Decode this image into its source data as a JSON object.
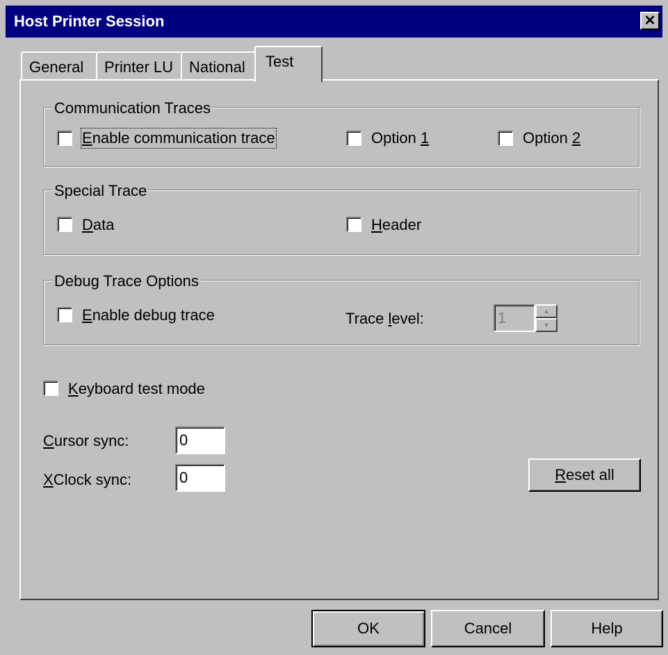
{
  "window": {
    "title": "Host Printer Session",
    "close_glyph": "✕"
  },
  "tabs": [
    {
      "label": "General",
      "active": false
    },
    {
      "label": "Printer LU",
      "active": false
    },
    {
      "label": "National",
      "active": false
    },
    {
      "label": "Test",
      "active": true
    }
  ],
  "communication_traces": {
    "title": "Communication Traces",
    "enable": {
      "label_ul": "E",
      "label_rest": "nable communication trace",
      "checked": false
    },
    "option1": {
      "label_pre": "Option ",
      "label_ul": "1",
      "checked": false
    },
    "option2": {
      "label_pre": "Option ",
      "label_ul": "2",
      "checked": false
    }
  },
  "special_trace": {
    "title": "Special Trace",
    "data": {
      "label_ul": "D",
      "label_rest": "ata",
      "checked": false
    },
    "header": {
      "label_ul": "H",
      "label_rest": "eader",
      "checked": false
    }
  },
  "debug_trace": {
    "title": "Debug Trace Options",
    "enable": {
      "label_ul": "E",
      "label_rest": "nable debug trace",
      "checked": false
    },
    "trace_level": {
      "label_pre": "Trace ",
      "label_ul": "l",
      "label_rest": "evel:",
      "value": "1",
      "disabled": true
    }
  },
  "keyboard_test_mode": {
    "label_ul": "K",
    "label_rest": "eyboard test mode",
    "checked": false
  },
  "cursor_sync": {
    "label_ul": "C",
    "label_rest": "ursor sync:",
    "value": "0"
  },
  "xclock_sync": {
    "label_ul": "X",
    "label_rest": "Clock sync:",
    "value": "0"
  },
  "buttons": {
    "reset_ul": "R",
    "reset_rest": "eset all",
    "ok": "OK",
    "cancel": "Cancel",
    "help": "Help"
  },
  "colors": {
    "titlebar": "#000080",
    "face": "#c0c0c0",
    "shadow": "#808080",
    "highlight": "#ffffff"
  }
}
